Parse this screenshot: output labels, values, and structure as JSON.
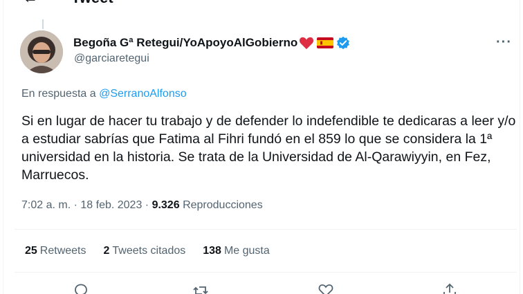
{
  "header": {
    "title": "Tweet"
  },
  "author": {
    "display_name": "Begoña Gª Retegui/YoApoyoAlGobierno",
    "handle": "@garciaretegui",
    "icons": [
      "heart-icon",
      "spain-flag-icon",
      "verified-icon"
    ]
  },
  "reply": {
    "prefix": "En respuesta a",
    "mention": "@SerranoAlfonso"
  },
  "tweet": {
    "text": "Si en lugar de hacer tu trabajo y de defender lo indefendible te dedicaras a leer y/o a estudiar sabrías que Fatima al Fihri fundó en el 859 lo que se considera la 1ª universidad en la historia. Se trata de la Universidad de Al-Qarawiyyin, en Fez, Marruecos."
  },
  "meta": {
    "time": "7:02 a. m.",
    "separator": " · ",
    "date": "18 feb. 2023",
    "views_count": "9.326",
    "views_label": "Reproducciones"
  },
  "stats": {
    "retweets_count": "25",
    "retweets_label": "Retweets",
    "quotes_count": "2",
    "quotes_label": "Tweets citados",
    "likes_count": "138",
    "likes_label": "Me gusta"
  },
  "colors": {
    "accent": "#1d9bf0",
    "muted": "#536471",
    "text": "#0f1419",
    "heart": "#e0245e"
  }
}
